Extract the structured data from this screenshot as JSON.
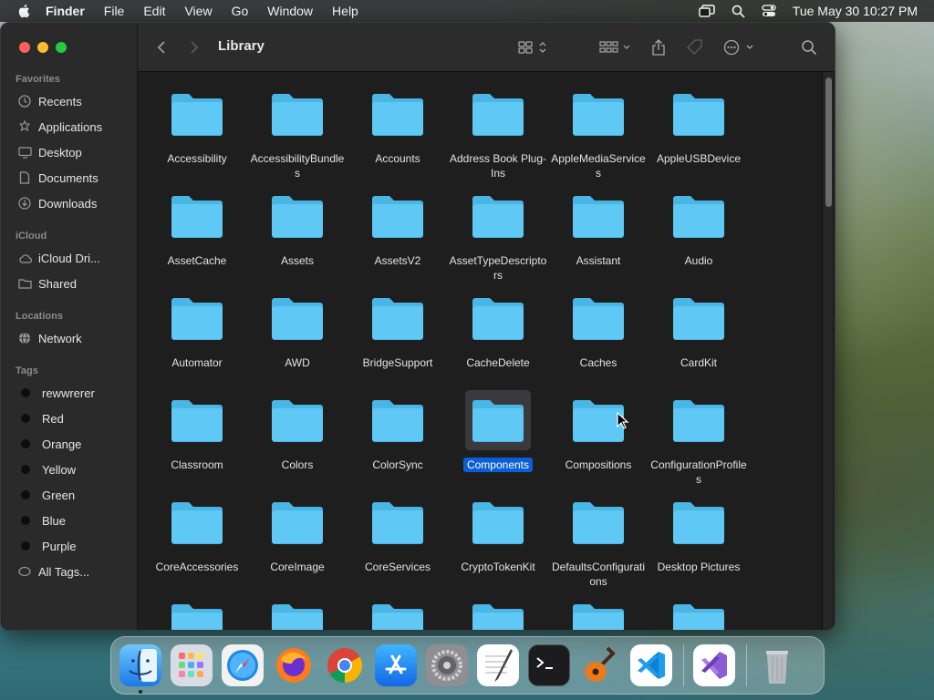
{
  "menubar": {
    "app_name": "Finder",
    "menus": [
      "File",
      "Edit",
      "View",
      "Go",
      "Window",
      "Help"
    ],
    "clock": "Tue May 30  10:27 PM"
  },
  "window": {
    "title": "Library"
  },
  "sidebar": {
    "favorites_label": "Favorites",
    "favorites": [
      {
        "label": "Recents",
        "icon": "clock-icon"
      },
      {
        "label": "Applications",
        "icon": "applications-icon"
      },
      {
        "label": "Desktop",
        "icon": "desktop-icon"
      },
      {
        "label": "Documents",
        "icon": "document-icon"
      },
      {
        "label": "Downloads",
        "icon": "download-icon"
      }
    ],
    "icloud_label": "iCloud",
    "icloud": [
      {
        "label": "iCloud Dri...",
        "icon": "cloud-icon"
      },
      {
        "label": "Shared",
        "icon": "shared-folder-icon"
      }
    ],
    "locations_label": "Locations",
    "locations": [
      {
        "label": "Network",
        "icon": "network-icon"
      }
    ],
    "tags_label": "Tags",
    "tags": [
      {
        "label": "rewwrerer"
      },
      {
        "label": "Red"
      },
      {
        "label": "Orange"
      },
      {
        "label": "Yellow"
      },
      {
        "label": "Green"
      },
      {
        "label": "Blue"
      },
      {
        "label": "Purple"
      },
      {
        "label": "All Tags..."
      }
    ]
  },
  "folders": [
    {
      "name": "Accessibility"
    },
    {
      "name": "AccessibilityBundles"
    },
    {
      "name": "Accounts"
    },
    {
      "name": "Address Book Plug-Ins"
    },
    {
      "name": "AppleMediaServices"
    },
    {
      "name": "AppleUSBDevice"
    },
    {
      "name": "AssetCache"
    },
    {
      "name": "Assets"
    },
    {
      "name": "AssetsV2"
    },
    {
      "name": "AssetTypeDescriptors"
    },
    {
      "name": "Assistant"
    },
    {
      "name": "Audio"
    },
    {
      "name": "Automator"
    },
    {
      "name": "AWD"
    },
    {
      "name": "BridgeSupport"
    },
    {
      "name": "CacheDelete"
    },
    {
      "name": "Caches"
    },
    {
      "name": "CardKit"
    },
    {
      "name": "Classroom"
    },
    {
      "name": "Colors"
    },
    {
      "name": "ColorSync"
    },
    {
      "name": "Components",
      "selected": true
    },
    {
      "name": "Compositions"
    },
    {
      "name": "ConfigurationProfiles"
    },
    {
      "name": "CoreAccessories"
    },
    {
      "name": "CoreImage"
    },
    {
      "name": "CoreServices"
    },
    {
      "name": "CryptoTokenKit"
    },
    {
      "name": "DefaultsConfigurations"
    },
    {
      "name": "Desktop Pictures"
    }
  ],
  "colors": {
    "folder": "#5fc8f5",
    "folder_tab": "#49b6e6",
    "selection": "#0a5ed7"
  },
  "dock": {
    "apps": [
      "finder-icon",
      "launchpad-icon",
      "safari-icon",
      "firefox-icon",
      "chrome-icon",
      "app-store-icon",
      "system-settings-icon",
      "textedit-icon",
      "terminal-icon",
      "garageband-icon",
      "vscode-icon",
      "visual-studio-icon",
      "trash-icon"
    ]
  }
}
